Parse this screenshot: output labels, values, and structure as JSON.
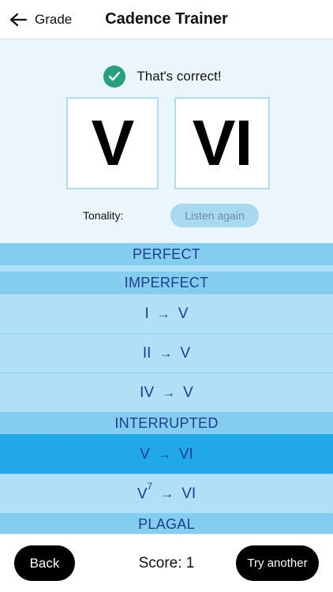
{
  "header": {
    "back_label": "Grade",
    "title": "Cadence Trainer",
    "back_icon": "arrow-left-icon"
  },
  "result": {
    "icon": "check-circle-icon",
    "icon_color": "#26a07a",
    "message": "That's correct!",
    "chord1": "V",
    "chord2": "VI"
  },
  "tonality": {
    "label": "Tonality:",
    "listen_label": "Listen again"
  },
  "sections": {
    "perfect": "PERFECT",
    "imperfect": "IMPERFECT",
    "interrupted": "INTERRUPTED",
    "plagal": "PLAGAL"
  },
  "items": {
    "i_v": {
      "from": "I",
      "arrow": "→",
      "to": "V"
    },
    "ii_v": {
      "from": "II",
      "arrow": "→",
      "to": "V"
    },
    "iv_v": {
      "from": "IV",
      "arrow": "→",
      "to": "V"
    },
    "v_vi": {
      "from": "V",
      "arrow": "→",
      "to": "VI",
      "selected": true
    },
    "v7_vi": {
      "from": "V",
      "sup": "7",
      "arrow": "→",
      "to": "VI"
    }
  },
  "footer": {
    "back_label": "Back",
    "score_text": "Score: 1",
    "try_label": "Try another"
  },
  "colors": {
    "selected": "#20a8e8",
    "section": "#85cdee",
    "item": "#b0e0f8",
    "text_blue": "#1b3e8f"
  }
}
